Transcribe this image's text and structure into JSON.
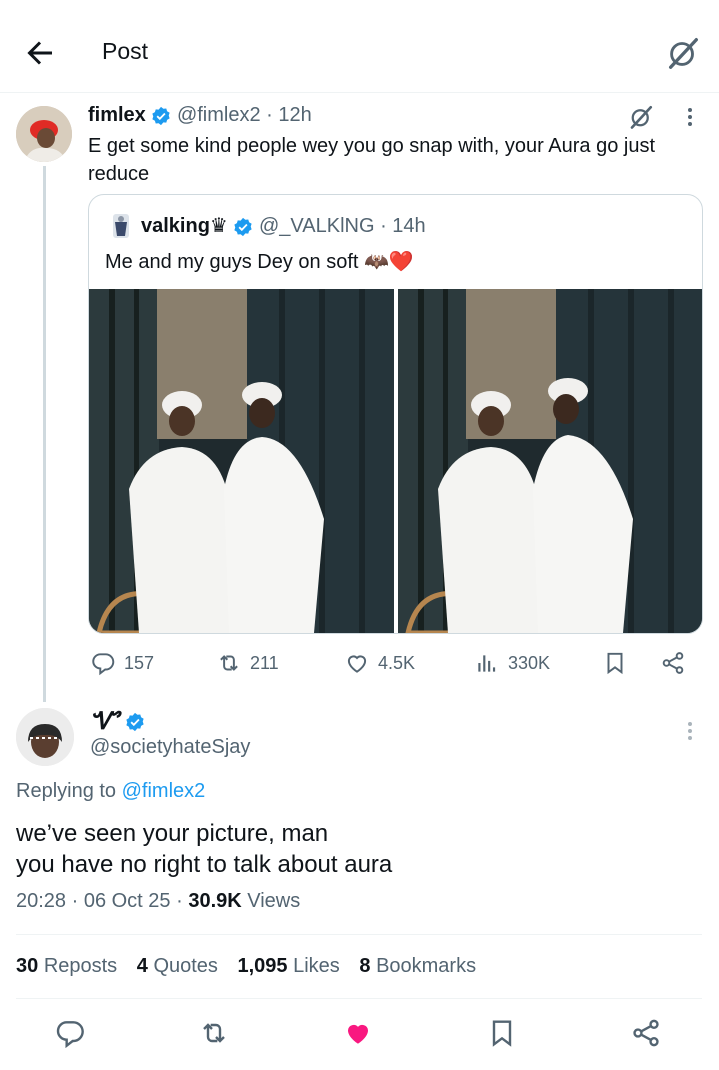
{
  "header": {
    "title": "Post",
    "back_icon": "arrow-left-icon",
    "grok_icon": "grok-icon"
  },
  "original_post": {
    "display_name": "fimlex",
    "handle": "@fimlex2",
    "time": "· 12h",
    "text": "E get some kind people wey you go snap with, your Aura go just reduce",
    "quoted": {
      "display_name": "valking",
      "crown_glyph": "♛",
      "handle": "@_VALKlNG",
      "time": "· 14h",
      "text": "Me and my guys Dey on soft 🦇❤️"
    },
    "actions": {
      "replies": "157",
      "reposts": "211",
      "likes": "4.5K",
      "views": "330K"
    }
  },
  "reply_post": {
    "display_name": "Ꮙ",
    "handle": "@societyhateSjay",
    "replying_prefix": "Replying to",
    "replying_to": "@fimlex2",
    "text_line1": "we’ve seen your picture, man",
    "text_line2": "you have no right to talk about aura",
    "timestamp": "20:28 · 06 Oct 25 · ",
    "views_count": "30.9K",
    "views_label": " Views",
    "stats": {
      "reposts_count": "30",
      "reposts_label": "Reposts",
      "quotes_count": "4",
      "quotes_label": "Quotes",
      "likes_count": "1,095",
      "likes_label": "Likes",
      "bookmarks_count": "8",
      "bookmarks_label": "Bookmarks"
    }
  },
  "colors": {
    "accent": "#1d9bf0",
    "like_active": "#f91880",
    "muted": "#536471",
    "text": "#0f1419"
  }
}
